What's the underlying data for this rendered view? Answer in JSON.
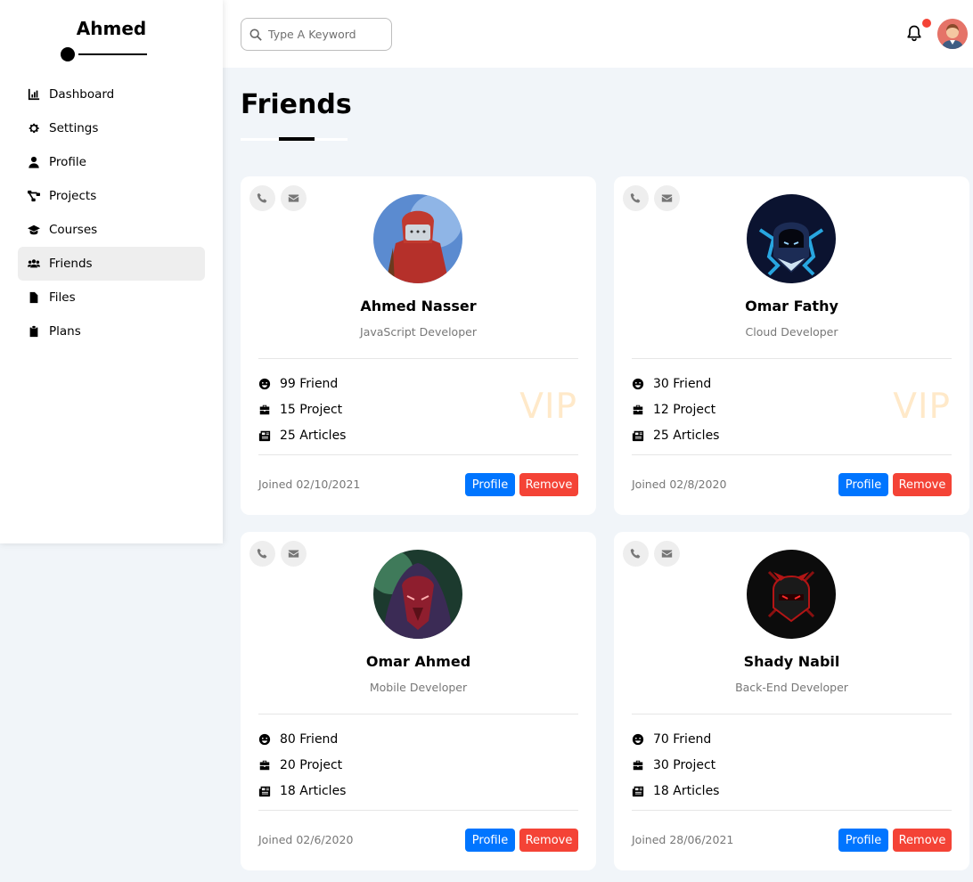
{
  "sidebar": {
    "brand": "Ahmed",
    "items": [
      {
        "label": "Dashboard",
        "icon": "chart-icon"
      },
      {
        "label": "Settings",
        "icon": "gear-icon"
      },
      {
        "label": "Profile",
        "icon": "user-icon"
      },
      {
        "label": "Projects",
        "icon": "diagram-icon"
      },
      {
        "label": "Courses",
        "icon": "graduation-cap-icon"
      },
      {
        "label": "Friends",
        "icon": "users-icon",
        "active": true
      },
      {
        "label": "Files",
        "icon": "file-icon"
      },
      {
        "label": "Plans",
        "icon": "clipboard-icon"
      }
    ]
  },
  "header": {
    "search_placeholder": "Type A Keyword"
  },
  "page": {
    "title": "Friends"
  },
  "colors": {
    "primary": "#0075ff",
    "danger": "#f44336",
    "background": "#f1f5f9",
    "vip": "#ffe9c9"
  },
  "friends": [
    {
      "name": "Ahmed Nasser",
      "job": "JavaScript Developer",
      "friends": "99 Friend",
      "projects": "15 Project",
      "articles": "25 Articles",
      "vip": "VIP",
      "joined": "Joined 02/10/2021",
      "profile_label": "Profile",
      "remove_label": "Remove"
    },
    {
      "name": "Omar Fathy",
      "job": "Cloud Developer",
      "friends": "30 Friend",
      "projects": "12 Project",
      "articles": "25 Articles",
      "vip": "VIP",
      "joined": "Joined 02/8/2020",
      "profile_label": "Profile",
      "remove_label": "Remove"
    },
    {
      "name": "Omar Ahmed",
      "job": "Mobile Developer",
      "friends": "80 Friend",
      "projects": "20 Project",
      "articles": "18 Articles",
      "vip": "",
      "joined": "Joined 02/6/2020",
      "profile_label": "Profile",
      "remove_label": "Remove"
    },
    {
      "name": "Shady Nabil",
      "job": "Back-End Developer",
      "friends": "70 Friend",
      "projects": "30 Project",
      "articles": "18 Articles",
      "vip": "",
      "joined": "Joined 28/06/2021",
      "profile_label": "Profile",
      "remove_label": "Remove"
    }
  ]
}
